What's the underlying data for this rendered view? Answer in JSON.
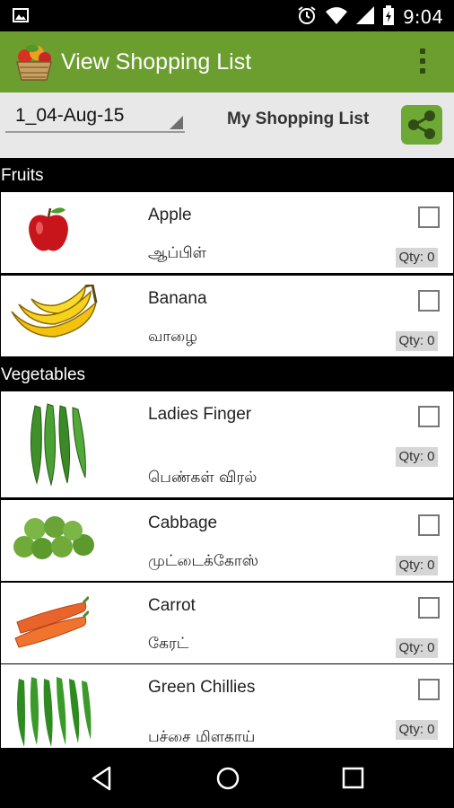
{
  "status": {
    "time": "9:04"
  },
  "appbar": {
    "title": "View Shopping List"
  },
  "toolbar": {
    "spinner_value": "1_04-Aug-15",
    "list_label": "My Shopping List"
  },
  "sections": [
    {
      "header": "Fruits",
      "items": [
        {
          "name": "Apple",
          "tamil": "ஆப்பிள்",
          "qty": "Qty: 0",
          "icon": "apple"
        },
        {
          "name": "Banana",
          "tamil": "வாழை",
          "qty": "Qty: 0",
          "icon": "banana"
        }
      ]
    },
    {
      "header": "Vegetables",
      "items": [
        {
          "name": "Ladies Finger",
          "tamil": "பெண்கள் விரல்",
          "qty": "Qty: 0",
          "icon": "okra"
        },
        {
          "name": "Cabbage",
          "tamil": "முட்டைக்கோஸ்",
          "qty": "Qty: 0",
          "icon": "cabbage"
        },
        {
          "name": "Carrot",
          "tamil": "கேரட்",
          "qty": "Qty: 0",
          "icon": "carrot"
        },
        {
          "name": "Green Chillies",
          "tamil": "பச்சை மிளகாய்",
          "qty": "Qty: 0",
          "icon": "chillies"
        }
      ]
    }
  ],
  "colors": {
    "appbar": "#6b9e2e",
    "share_button": "#6ea835"
  }
}
